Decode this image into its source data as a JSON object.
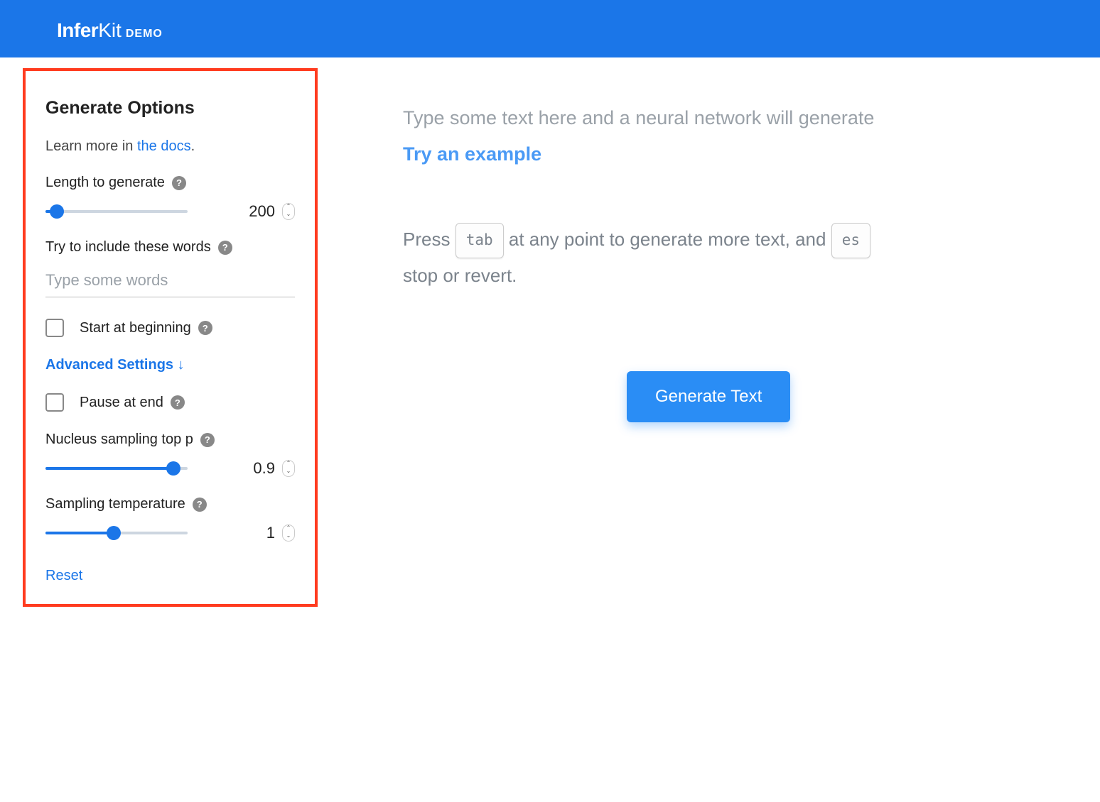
{
  "header": {
    "brand_bold": "Infer",
    "brand_light": "Kit",
    "demo": "DEMO"
  },
  "sidebar": {
    "title": "Generate Options",
    "learn_prefix": "Learn more in ",
    "learn_link": "the docs",
    "learn_suffix": ".",
    "length": {
      "label": "Length to generate",
      "value": "200",
      "fill_pct": 8
    },
    "keywords": {
      "label": "Try to include these words",
      "placeholder": "Type some words",
      "value": ""
    },
    "start_beginning": {
      "label": "Start at beginning",
      "checked": false
    },
    "advanced_label": "Advanced Settings ↓",
    "pause_end": {
      "label": "Pause at end",
      "checked": false
    },
    "top_p": {
      "label": "Nucleus sampling top p",
      "value": "0.9",
      "fill_pct": 90
    },
    "temperature": {
      "label": "Sampling temperature",
      "value": "1",
      "fill_pct": 48
    },
    "reset": "Reset"
  },
  "editor": {
    "placeholder": "Type some text here and a neural network will generate",
    "try_example": "Try an example",
    "instr_1": "Press ",
    "key_tab": "tab",
    "instr_2": " at any point to generate more text, and ",
    "key_esc": "es",
    "instr_3": "stop or revert.",
    "generate_btn": "Generate Text"
  }
}
